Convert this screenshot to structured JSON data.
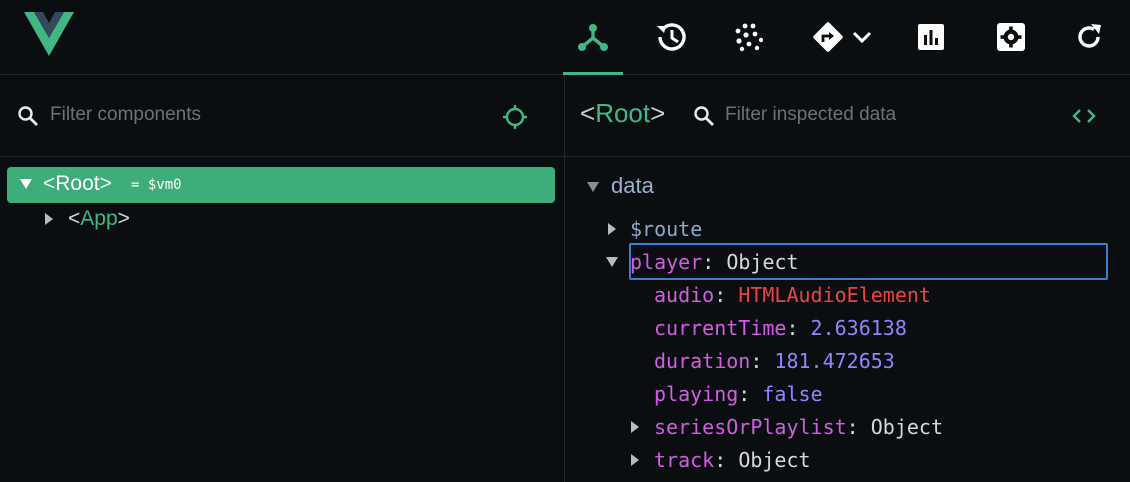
{
  "toolbar": {
    "logo": "vue-logo",
    "tabs": [
      {
        "name": "components-tab",
        "icon": "component-tree-icon",
        "active": true
      },
      {
        "name": "timeline-tab",
        "icon": "history-icon",
        "active": false
      },
      {
        "name": "vuex-tab",
        "icon": "dots-grid-icon",
        "active": false
      },
      {
        "name": "routing-tab",
        "icon": "route-sign-icon",
        "active": false
      },
      {
        "name": "performance-tab",
        "icon": "bar-chart-icon",
        "active": false
      },
      {
        "name": "settings-tab",
        "icon": "gear-icon",
        "active": false
      },
      {
        "name": "refresh-tab",
        "icon": "refresh-icon",
        "active": false
      }
    ]
  },
  "components_panel": {
    "filter_placeholder": "Filter components",
    "tree": [
      {
        "open_bracket": "<",
        "name": "Root",
        "close_bracket": ">",
        "assignment": "= $vm0",
        "expanded": true,
        "selected": true
      },
      {
        "open_bracket": "<",
        "name": "App",
        "close_bracket": ">",
        "expanded": false,
        "selected": false
      }
    ]
  },
  "inspector": {
    "title_open": "<",
    "title_name": "Root",
    "title_close": ">",
    "filter_placeholder": "Filter inspected data",
    "section": "data",
    "rows": [
      {
        "key": "$route",
        "colon": "",
        "value": ""
      },
      {
        "key": "player",
        "colon": ": ",
        "value": "Object"
      },
      {
        "key": "audio",
        "colon": ": ",
        "value": "HTMLAudioElement"
      },
      {
        "key": "currentTime",
        "colon": ": ",
        "value": "2.636138"
      },
      {
        "key": "duration",
        "colon": ": ",
        "value": "181.472653"
      },
      {
        "key": "playing",
        "colon": ": ",
        "value": "false"
      },
      {
        "key": "seriesOrPlaylist",
        "colon": ": ",
        "value": "Object"
      },
      {
        "key": "track",
        "colon": ": ",
        "value": "Object"
      }
    ]
  },
  "colors": {
    "accent": "#41b883",
    "background": "#0b0e11",
    "key": "#d05ee0",
    "number": "#8f86ff",
    "class": "#e64545",
    "selection": "#3a7ed6"
  }
}
